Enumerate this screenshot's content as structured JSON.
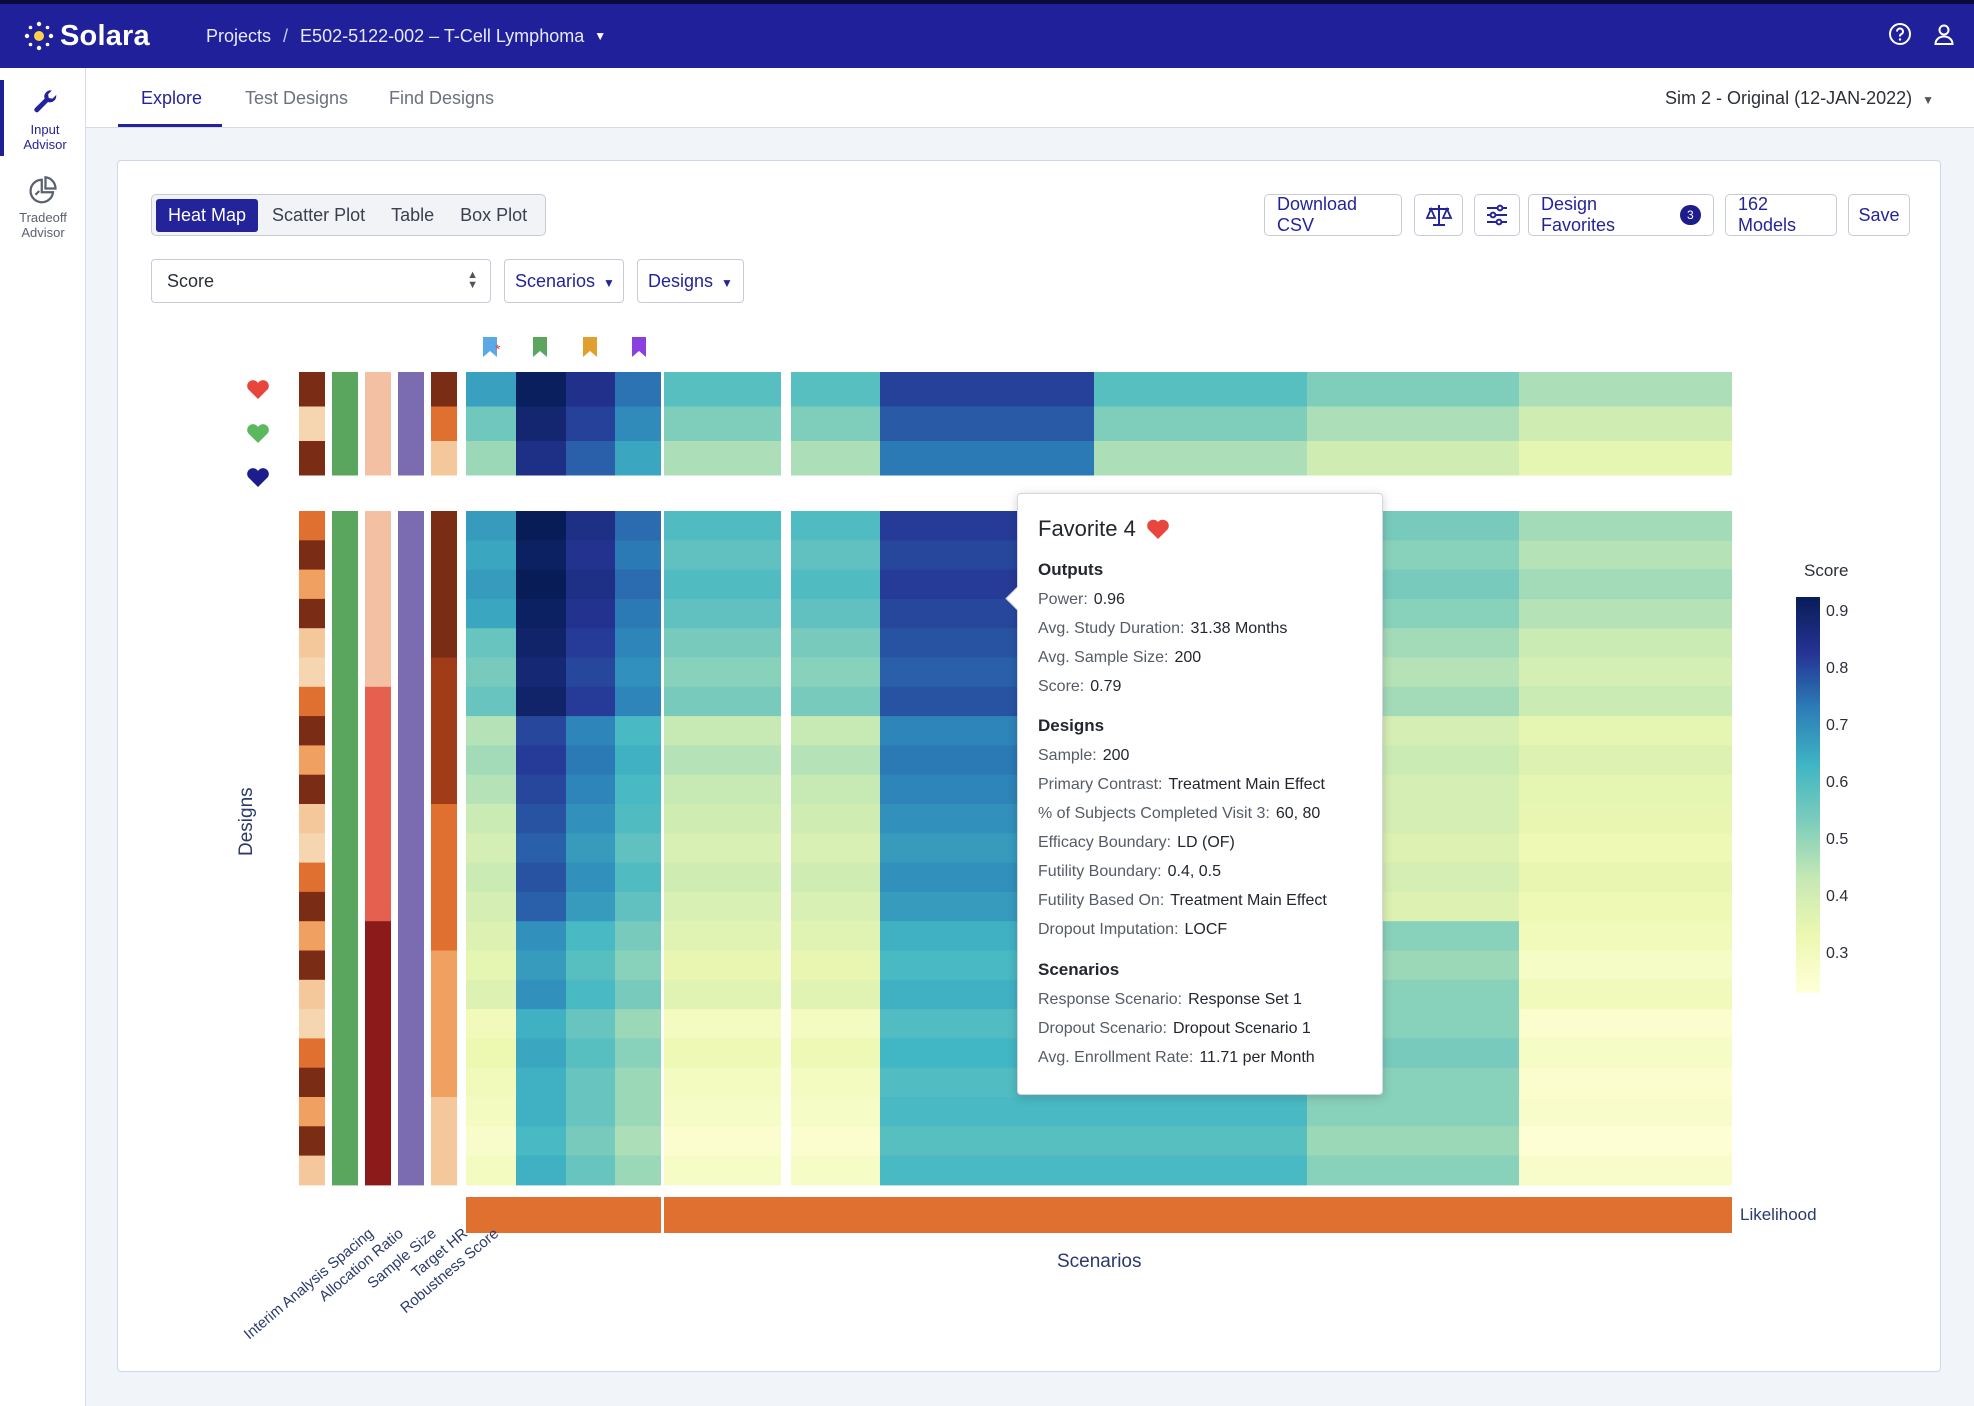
{
  "app": {
    "name": "Solara",
    "breadcrumb": {
      "projects": "Projects",
      "separator": "/",
      "project": "E502-5122-002 – T-Cell Lymphoma"
    }
  },
  "rail": {
    "items": [
      {
        "label1": "Input",
        "label2": "Advisor",
        "icon": "wrench-icon",
        "active": true
      },
      {
        "label1": "Tradeoff",
        "label2": "Advisor",
        "icon": "pie-chart-icon",
        "active": false
      }
    ]
  },
  "tabs": [
    "Explore",
    "Test Designs",
    "Find Designs"
  ],
  "simulation": "Sim 2 - Original (12-JAN-2022)",
  "views": [
    "Heat Map",
    "Scatter Plot",
    "Table",
    "Box Plot"
  ],
  "toolbar": {
    "download": "Download CSV",
    "favorites": "Design Favorites",
    "favorites_count": "3",
    "models": "162 Models",
    "save": "Save"
  },
  "controls": {
    "metric": "Score",
    "scenarios": "Scenarios",
    "designs": "Designs"
  },
  "heatmap": {
    "ylabel": "Designs",
    "xlabel": "Scenarios",
    "likelihood_label": "Likelihood",
    "colorbar_title": "Score",
    "colorbar_ticks": [
      "0.9",
      "0.8",
      "0.7",
      "0.6",
      "0.5",
      "0.4",
      "0.3"
    ],
    "feature_labels": [
      "Interim Analysis Spacing",
      "Allocation Ratio",
      "Sample Size",
      "Target HR",
      "Robustness Score"
    ],
    "colors": {
      "low": "#ffffd9",
      "high": "#081d58",
      "likelihood": "#e07030"
    }
  },
  "chart_data": {
    "type": "heatmap",
    "title": "",
    "xlabel": "Scenarios",
    "ylabel": "Designs",
    "colorbar": {
      "title": "Score",
      "range": [
        0.25,
        0.93
      ]
    },
    "favorites_rows": 3,
    "scenario_count": 10,
    "values_by_design_block": [
      [
        0.62,
        0.92,
        0.82,
        0.7,
        0.55,
        0.78,
        0.55,
        0.5,
        0.55,
        0.45
      ],
      [
        0.52,
        0.88,
        0.78,
        0.66,
        0.5,
        0.74,
        0.5,
        0.45,
        0.48,
        0.4
      ],
      [
        0.45,
        0.78,
        0.68,
        0.58,
        0.43,
        0.68,
        0.45,
        0.4,
        0.4,
        0.36
      ],
      [
        0.4,
        0.74,
        0.64,
        0.55,
        0.39,
        0.64,
        0.41,
        0.38,
        0.36,
        0.33
      ],
      [
        0.36,
        0.64,
        0.56,
        0.5,
        0.35,
        0.58,
        0.55,
        0.48,
        0.34,
        0.3
      ],
      [
        0.32,
        0.6,
        0.54,
        0.48,
        0.31,
        0.57,
        0.57,
        0.5,
        0.31,
        0.28
      ],
      [
        0.29,
        0.58,
        0.52,
        0.46,
        0.28,
        0.56,
        0.56,
        0.48,
        0.29,
        0.27
      ]
    ]
  },
  "tooltip": {
    "title": "Favorite 4",
    "outputs_title": "Outputs",
    "outputs": [
      {
        "k": "Power:",
        "v": "0.96"
      },
      {
        "k": "Avg. Study Duration:",
        "v": "31.38 Months"
      },
      {
        "k": "Avg. Sample Size:",
        "v": "200"
      },
      {
        "k": "Score:",
        "v": "0.79"
      }
    ],
    "designs_title": "Designs",
    "designs": [
      {
        "k": "Sample:",
        "v": "200"
      },
      {
        "k": "Primary Contrast:",
        "v": "Treatment Main Effect"
      },
      {
        "k": "% of Subjects Completed Visit 3:",
        "v": "60, 80"
      },
      {
        "k": "Efficacy Boundary:",
        "v": "LD (OF)"
      },
      {
        "k": "Futility Boundary:",
        "v": "0.4, 0.5"
      },
      {
        "k": "Futility Based On:",
        "v": "Treatment Main Effect"
      },
      {
        "k": "Dropout Imputation:",
        "v": "LOCF"
      }
    ],
    "scenarios_title": "Scenarios",
    "scenarios": [
      {
        "k": "Response Scenario:",
        "v": "Response Set 1"
      },
      {
        "k": "Dropout Scenario:",
        "v": "Dropout Scenario 1"
      },
      {
        "k": "Avg. Enrollment Rate:",
        "v": "11.71 per Month"
      }
    ]
  }
}
